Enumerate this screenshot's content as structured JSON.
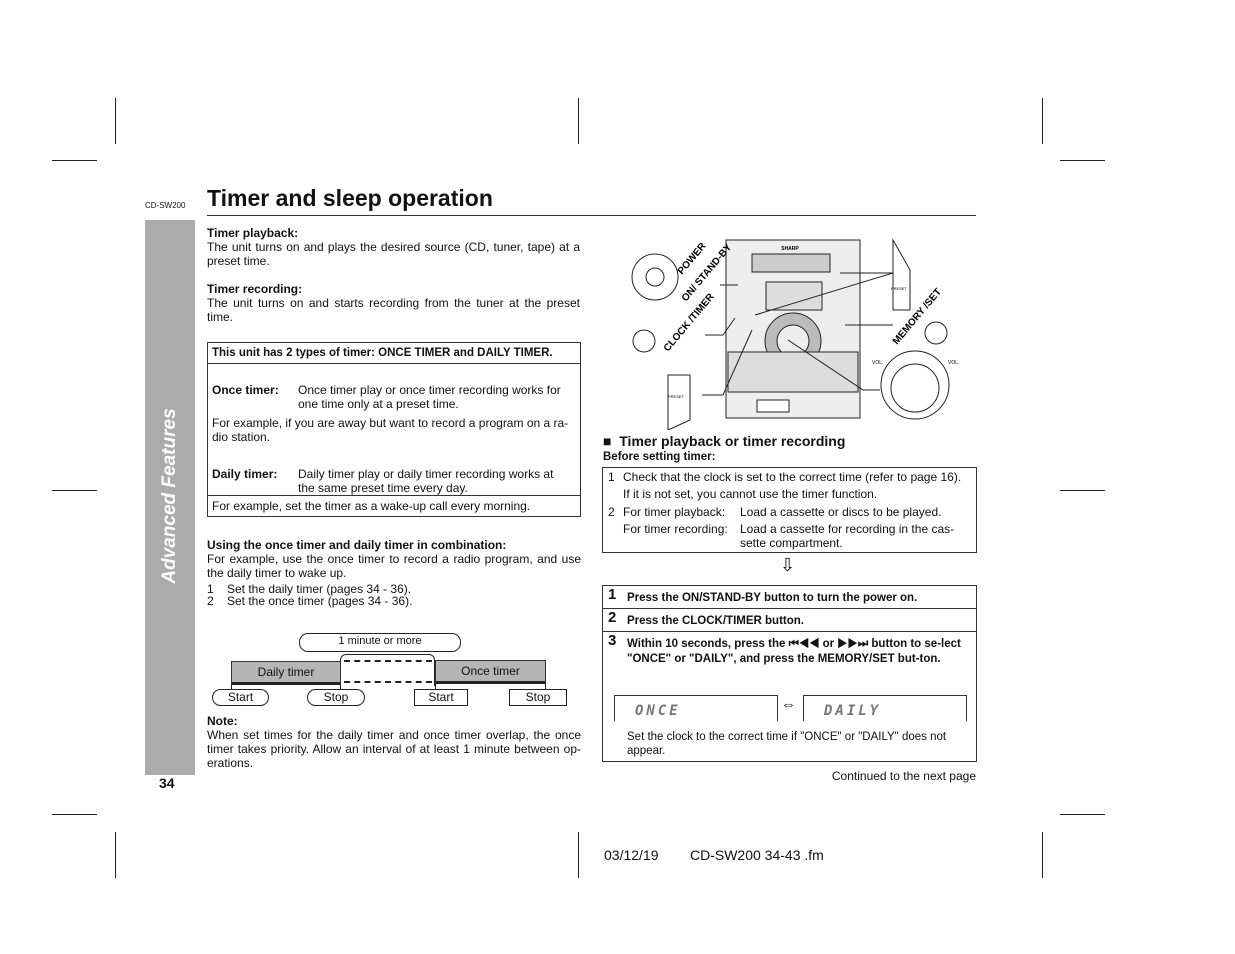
{
  "header": {
    "model": "CD-SW200",
    "title": "Timer and sleep operation"
  },
  "sidebar": {
    "section": "Advanced Features",
    "page_number": "34"
  },
  "left": {
    "playback_heading": "Timer playback:",
    "playback_text": "The unit turns on and plays the desired source (CD, tuner, tape) at a preset time.",
    "recording_heading": "Timer recording:",
    "recording_text": "The unit turns on and starts recording from the tuner at the preset time.",
    "box": {
      "title": "This unit has 2 types of timer: ONCE TIMER and DAILY TIMER.",
      "once_label": "Once timer:",
      "once_text": "Once timer play or once timer recording works for one time only at a preset time.",
      "once_example": "For example, if you are away but want to record a program on a ra-dio station.",
      "daily_label": "Daily timer:",
      "daily_text": "Daily timer play or daily timer recording works at the same preset time every day.",
      "daily_example": "For example, set the timer as a wake-up call every morning."
    },
    "combo_heading": "Using the once timer and daily timer in combination:",
    "combo_text": "For example, use the once timer to record a radio program, and use the daily timer to wake up.",
    "combo_steps": [
      {
        "n": "1",
        "text": "Set the daily timer (pages 34 - 36)."
      },
      {
        "n": "2",
        "text": "Set the once timer (pages 34 - 36)."
      }
    ],
    "diagram": {
      "gap": "1 minute or more",
      "daily": "Daily timer",
      "once": "Once timer",
      "start": "Start",
      "stop": "Stop"
    },
    "note_heading": "Note:",
    "note_text": "When set times for the daily timer and once timer overlap, the once timer takes priority. Allow an interval of at least 1 minute between op-erations."
  },
  "illustration": {
    "power": "POWER",
    "on_standby": "ON/ STAND-BY",
    "clock_timer": "CLOCK /TIMER",
    "memory_set": "MEMORY /SET",
    "brand": "SHARP",
    "vol": "VOL.",
    "preset": "PRESET"
  },
  "right": {
    "section_title": "Timer playback or timer recording",
    "before_heading": "Before setting timer:",
    "before": [
      {
        "n": "1",
        "text": "Check that the clock is set to the correct time (refer to page 16).",
        "sub": "If it is not set, you cannot use the timer function."
      },
      {
        "n": "2",
        "label": "For timer playback:",
        "text": "Load a cassette or discs to be played."
      },
      {
        "label": "For timer recording:",
        "text": "Load a cassette for recording in the cas-sette compartment."
      }
    ],
    "steps": [
      {
        "n": "1",
        "text": "Press the ON/STAND-BY button to turn the power on."
      },
      {
        "n": "2",
        "text": "Press the CLOCK/TIMER button."
      },
      {
        "n": "3",
        "text": "Within 10 seconds, press the ⏮◀◀ or ▶▶⏭ button to se-lect \"ONCE\" or \"DAILY\", and press the MEMORY/SET but-ton."
      }
    ],
    "display_once": "ONCE",
    "display_daily": "DAILY",
    "display_note": "Set the clock to the correct time if \"ONCE\" or \"DAILY\" does not appear.",
    "continued": "Continued to the next page"
  },
  "footer": {
    "date": "03/12/19",
    "file": "CD-SW200 34-43 .fm"
  }
}
